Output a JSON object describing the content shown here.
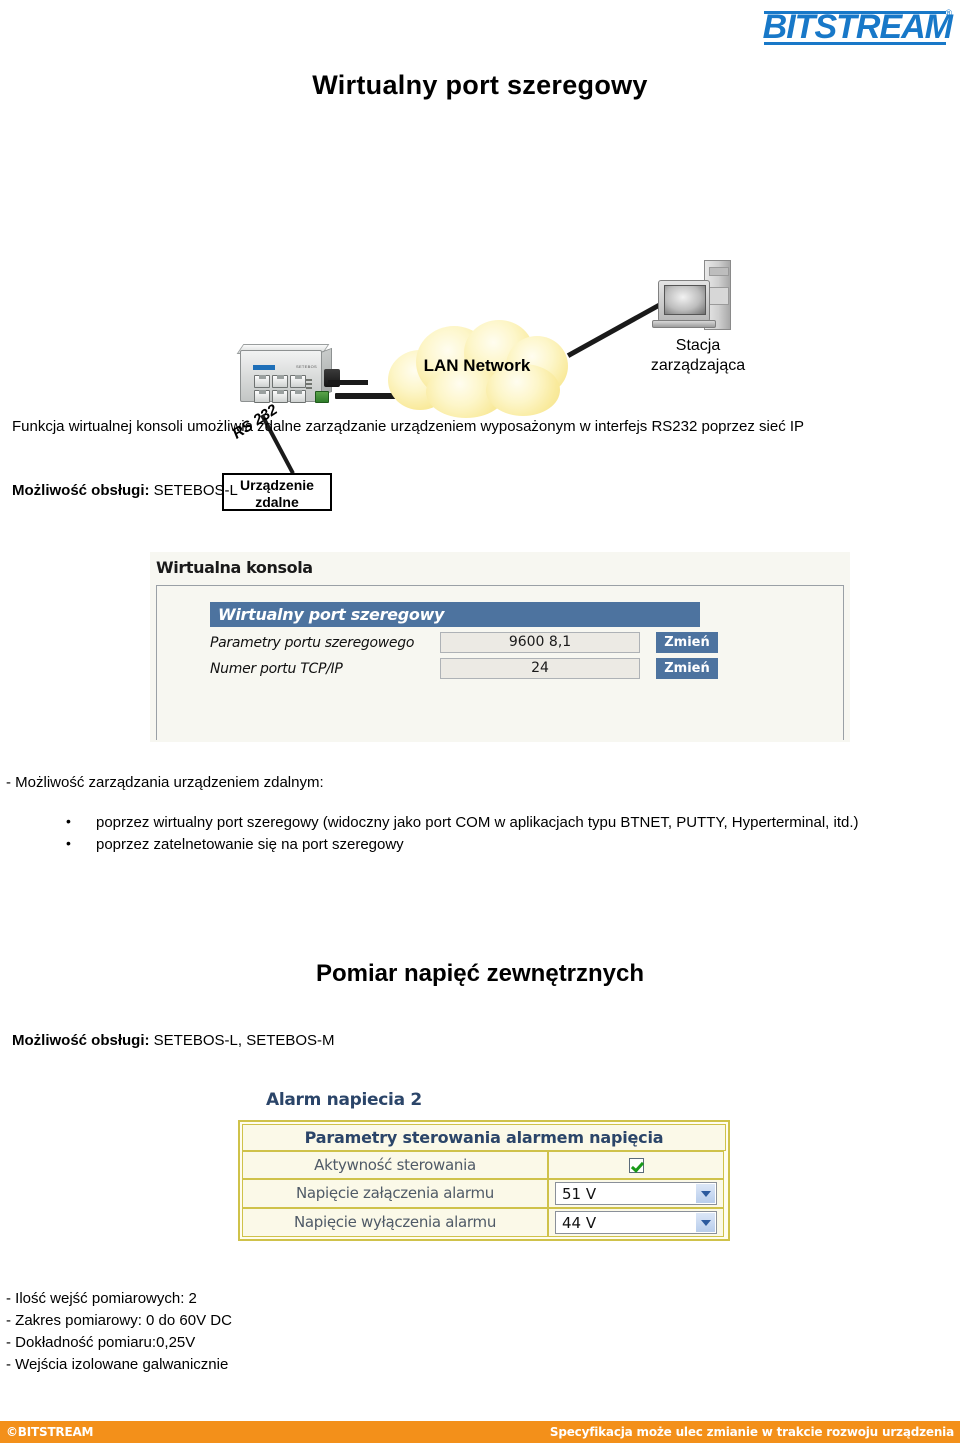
{
  "brand": {
    "logo_text": "BITSTREAM",
    "logo_registered": "®",
    "accent_blue": "#1878c8",
    "footer_orange": "#f3901a",
    "table_header_blue": "#4d739f",
    "alarm_border_yellow": "#cfc24a"
  },
  "page_title": "Wirtualny port szeregowy",
  "diagram": {
    "cloud_label": "LAN Network",
    "station_label": "Stacja\nzarządzająca",
    "station_label_line1": "Stacja",
    "station_label_line2": "zarządzająca",
    "serial_link_label": "RS 232",
    "remote_device_line1": "Urządzenie",
    "remote_device_line2": "zdalne",
    "device_brand": "BITSTREAM",
    "device_model": "SETEBOS"
  },
  "intro_paragraph": "Funkcja wirtualnej konsoli umożliwia zdalne zarządzanie urządzeniem wyposażonym w interfejs RS232 poprzez sieć IP",
  "support_1": {
    "label": "Możliwość obsługi:",
    "value": "SETEBOS-L"
  },
  "console_screenshot": {
    "panel_title": "Wirtualna konsola",
    "table_header": "Wirtualny port szeregowy",
    "rows": [
      {
        "label": "Parametry portu szeregowego",
        "value": "9600 8,1",
        "button": "Zmień"
      },
      {
        "label": "Numer portu TCP/IP",
        "value": "24",
        "button": "Zmień"
      }
    ]
  },
  "manage_section": {
    "heading": "- Możliwość zarządzania urządzeniem zdalnym:",
    "bullets": [
      "poprzez wirtualny port szeregowy (widoczny jako port COM w aplikacjach typu BTNET, PUTTY, Hyperterminal, itd.)",
      "poprzez zatelnetowanie się na port szeregowy"
    ]
  },
  "section_2_title": "Pomiar napięć zewnętrznych",
  "support_2": {
    "label": "Możliwość obsługi:",
    "value": "SETEBOS-L, SETEBOS-M"
  },
  "alarm_screenshot": {
    "panel_title": "Alarm napiecia 2",
    "table_header": "Parametry sterowania alarmem napięcia",
    "rows": [
      {
        "label": "Aktywność sterowania",
        "type": "checkbox",
        "checked": true,
        "value": ""
      },
      {
        "label": "Napięcie załączenia alarmu",
        "type": "select",
        "value": "51 V"
      },
      {
        "label": "Napięcie wyłączenia alarmu",
        "type": "select",
        "value": "44 V"
      }
    ]
  },
  "specs": [
    "- Ilość wejść pomiarowych: 2",
    "- Zakres pomiarowy: 0 do 60V DC",
    "- Dokładność pomiaru:0,25V",
    "- Wejścia izolowane galwanicznie"
  ],
  "footer": {
    "left": "©BITSTREAM",
    "right": "Specyfikacja może ulec zmianie w  trakcie rozwoju urządzenia"
  }
}
